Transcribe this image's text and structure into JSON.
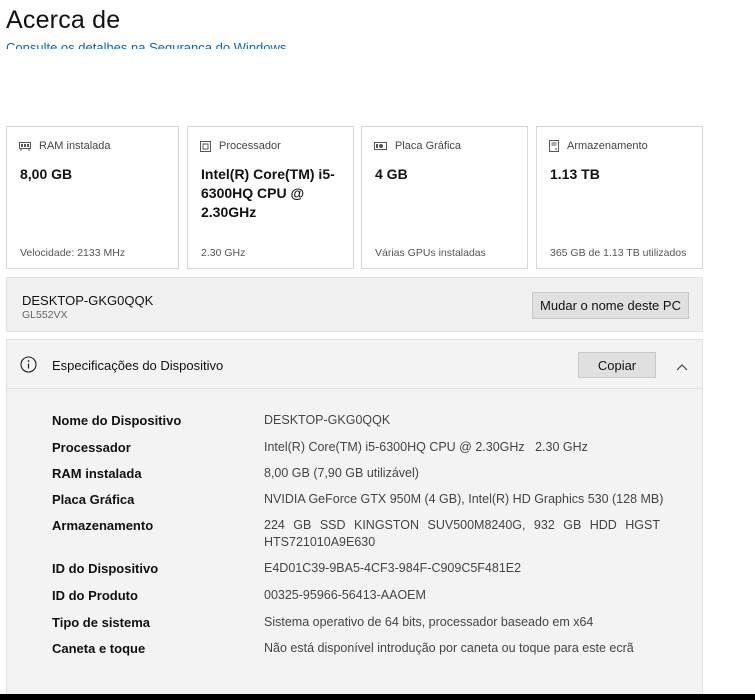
{
  "header": {
    "title": "Acerca de",
    "link": "Consulte os detalhes na Segurança do Windows"
  },
  "cards": [
    {
      "icon": "ram-icon",
      "label": "RAM instalada",
      "value": "8,00 GB",
      "footer": "Velocidade: 2133 MHz"
    },
    {
      "icon": "processor-icon",
      "label": "Processador",
      "value": "Intel(R) Core(TM) i5-6300HQ CPU @ 2.30GHz",
      "footer": "2.30 GHz"
    },
    {
      "icon": "graphics-card-icon",
      "label": "Placa Gráfica",
      "value": "4 GB",
      "footer": "Várias GPUs instaladas"
    },
    {
      "icon": "storage-icon",
      "label": "Armazenamento",
      "value": "1.13 TB",
      "footer": "365 GB de 1.13 TB utilizados"
    }
  ],
  "pc": {
    "name": "DESKTOP-GKG0QQK",
    "model": "GL552VX",
    "rename_label": "Mudar o nome deste PC"
  },
  "specs": {
    "title": "Especificações do Dispositivo",
    "copy_label": "Copiar",
    "rows": [
      {
        "label": "Nome do Dispositivo",
        "value": "DESKTOP-GKG0QQK"
      },
      {
        "label": "Processador",
        "value": "Intel(R) Core(TM) i5-6300HQ CPU @ 2.30GHz   2.30 GHz"
      },
      {
        "label": "RAM instalada",
        "value": "8,00 GB (7,90 GB utilizável)"
      },
      {
        "label": "Placa Gráfica",
        "value": "NVIDIA GeForce GTX 950M (4 GB), Intel(R) HD Graphics 530 (128 MB)"
      },
      {
        "label": "Armazenamento",
        "value": "224 GB SSD KINGSTON SUV500M8240G, 932 GB HDD HGST HTS721010A9E630"
      },
      {
        "label": "ID do Dispositivo",
        "value": "E4D01C39-9BA5-4CF3-984F-C909C5F481E2"
      },
      {
        "label": "ID do Produto",
        "value": "00325-95966-56413-AAOEM"
      },
      {
        "label": "Tipo de sistema",
        "value": "Sistema operativo de 64 bits, processador baseado em x64"
      },
      {
        "label": "Caneta e toque",
        "value": "Não está disponível introdução por caneta ou toque para este ecrã"
      }
    ]
  }
}
